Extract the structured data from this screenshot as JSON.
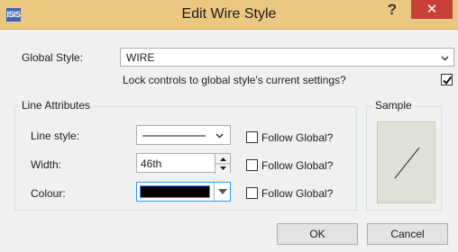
{
  "window": {
    "title": "Edit Wire Style",
    "app_icon_text": "ISIS",
    "help_label": "?",
    "close_label": "✕"
  },
  "global_style": {
    "label": "Global Style:",
    "value": "WIRE",
    "lock_label": "Lock controls to global style's current settings?",
    "lock_checked": true
  },
  "line_attributes": {
    "group_title": "Line Attributes",
    "line_style_label": "Line style:",
    "width_label": "Width:",
    "width_value": "46th",
    "colour_label": "Colour:",
    "colour_value": "#000000",
    "follow_global_label": "Follow Global?"
  },
  "sample": {
    "group_title": "Sample"
  },
  "buttons": {
    "ok": "OK",
    "cancel": "Cancel"
  },
  "colors": {
    "titlebar": "#ecc780",
    "close": "#c7413a",
    "sample_bg": "#e0e0d6"
  }
}
